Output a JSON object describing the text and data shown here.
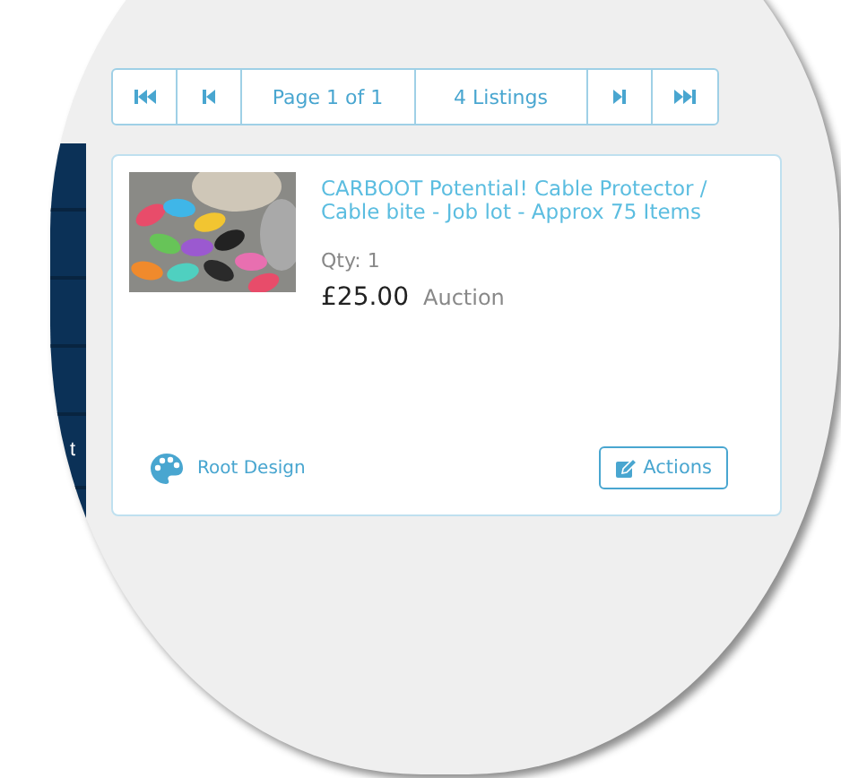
{
  "sidebar": {
    "items": [
      {
        "label": "t"
      }
    ]
  },
  "pager": {
    "items": [
      {
        "kind": "first"
      },
      {
        "kind": "prev"
      },
      {
        "kind": "text",
        "label": "Page 1 of 1"
      },
      {
        "kind": "text",
        "label": "4 Listings"
      },
      {
        "kind": "next"
      },
      {
        "kind": "last"
      }
    ]
  },
  "listing": {
    "title": "CARBOOT Potential! Cable Protector / Cable bite - Job lot - Approx 75 Items",
    "qty": "Qty: 1",
    "price": "£25.00",
    "format": "Auction",
    "design": "Root Design",
    "action": "Actions"
  }
}
